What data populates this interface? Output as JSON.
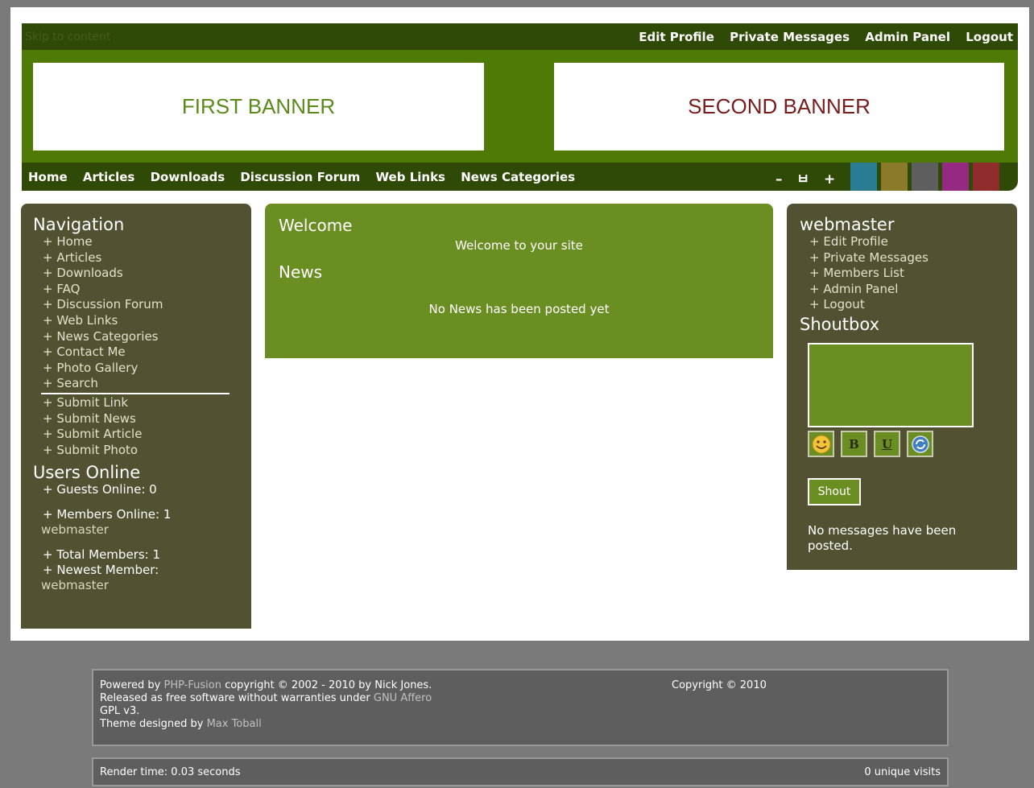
{
  "topbar": {
    "skip_link": "Skip to content",
    "user_links": [
      "Edit Profile",
      "Private Messages",
      "Admin Panel",
      "Logout"
    ]
  },
  "banners": {
    "first": "FIRST BANNER",
    "second": "SECOND BANNER"
  },
  "main_nav": {
    "items": [
      "Home",
      "Articles",
      "Downloads",
      "Discussion Forum",
      "Web Links",
      "News Categories"
    ],
    "font_controls": [
      "–",
      "ㅂ",
      "+"
    ]
  },
  "color_swatches": [
    "#2a7c92",
    "#8a7a2a",
    "#5e5e5e",
    "#962a82",
    "#902c2c"
  ],
  "left_panel": {
    "navigation_title": "Navigation",
    "nav_items": [
      "+ Home",
      "+ Articles",
      "+ Downloads",
      "+ FAQ",
      "+ Discussion Forum",
      "+ Web Links",
      "+ News Categories",
      "+ Contact Me",
      "+ Photo Gallery",
      "+ Search"
    ],
    "submit_items": [
      "+ Submit Link",
      "+ Submit News",
      "+ Submit Article",
      "+ Submit Photo"
    ],
    "users_online_title": "Users Online",
    "guests_online": "+ Guests Online: 0",
    "members_online": "+ Members Online: 1",
    "members_online_name": "webmaster",
    "total_members": "+ Total Members: 1",
    "newest_member": "+ Newest Member:",
    "newest_member_name": "webmaster"
  },
  "center": {
    "welcome_title": "Welcome",
    "welcome_text": "Welcome to your site",
    "news_title": "News",
    "news_text": "No News has been posted yet"
  },
  "right_panel": {
    "user_title": "webmaster",
    "user_links": [
      "+ Edit Profile",
      "+ Private Messages",
      "+ Members List",
      "+ Admin Panel",
      "+ Logout"
    ],
    "shoutbox_title": "Shoutbox",
    "shout_buttons": [
      "smiley-icon",
      "B",
      "U",
      "refresh-icon"
    ],
    "shout_button": "Shout",
    "no_messages": "No messages have been posted."
  },
  "footer": {
    "powered_by": "Powered by ",
    "php_fusion": "PHP-Fusion",
    "copyright_text": " copyright © 2002 - 2010 by Nick Jones.",
    "released_text": "Released as free software without warranties under ",
    "license_link": "GNU Affero",
    "license_tail": "GPL v3.",
    "theme_text": "Theme designed by ",
    "theme_author": "Max Toball",
    "site_copyright": "Copyright © 2010"
  },
  "render_bar": {
    "render_time": "Render time: 0.03 seconds",
    "visits": "0 unique visits"
  }
}
